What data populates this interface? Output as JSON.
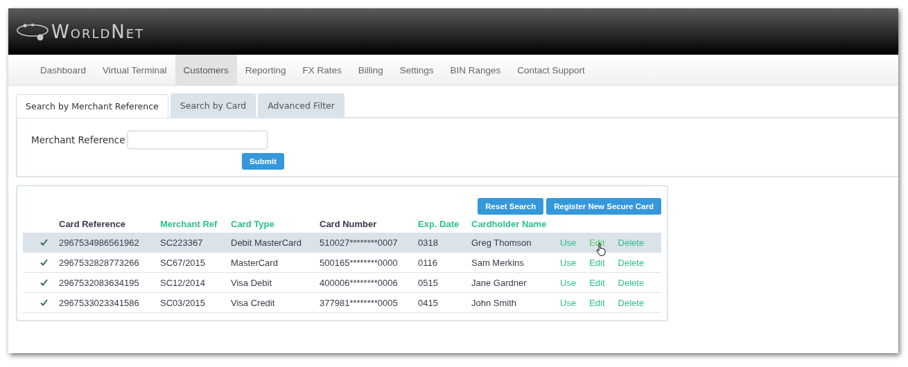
{
  "brand": {
    "logo_text": "WorldNet"
  },
  "nav": [
    {
      "label": "Dashboard",
      "selected": false
    },
    {
      "label": "Virtual Terminal",
      "selected": false
    },
    {
      "label": "Customers",
      "selected": true
    },
    {
      "label": "Reporting",
      "selected": false
    },
    {
      "label": "FX Rates",
      "selected": false
    },
    {
      "label": "Billing",
      "selected": false
    },
    {
      "label": "Settings",
      "selected": false
    },
    {
      "label": "BIN Ranges",
      "selected": false
    },
    {
      "label": "Contact Support",
      "selected": false
    }
  ],
  "search_tabs": [
    {
      "label": "Search by Merchant Reference",
      "selected": true
    },
    {
      "label": "Search by Card",
      "selected": false
    },
    {
      "label": "Advanced Filter",
      "selected": false
    }
  ],
  "search_form": {
    "label": "Merchant Reference",
    "submit": "Submit"
  },
  "actions": [
    "Reset Search",
    "Register New Secure Card"
  ],
  "table": {
    "columns": [
      {
        "label": "Card Reference",
        "sortable": false
      },
      {
        "label": "Merchant Ref",
        "sortable": true
      },
      {
        "label": "Card Type",
        "sortable": true
      },
      {
        "label": "Card Number",
        "sortable": false
      },
      {
        "label": "Exp. Date",
        "sortable": true
      },
      {
        "label": "Cardholder Name",
        "sortable": true
      }
    ],
    "rows": [
      {
        "active": true,
        "selected": true,
        "pointer": true,
        "cells": [
          "2967534986561962",
          "SC223367",
          "Debit MasterCard",
          "510027********0007",
          "0318",
          "Greg Thomson"
        ],
        "links": [
          "Use",
          "Edit",
          "Delete"
        ]
      },
      {
        "active": true,
        "selected": false,
        "pointer": false,
        "cells": [
          "2967532828773266",
          "SC67/2015",
          "MasterCard",
          "500165********0000",
          "0116",
          "Sam Merkins"
        ],
        "links": [
          "Use",
          "Edit",
          "Delete"
        ]
      },
      {
        "active": true,
        "selected": false,
        "pointer": false,
        "cells": [
          "2967532083634195",
          "SC12/2014",
          "Visa Debit",
          "400006********0006",
          "0515",
          "Jane Gardner"
        ],
        "links": [
          "Use",
          "Edit",
          "Delete"
        ]
      },
      {
        "active": true,
        "selected": false,
        "pointer": false,
        "cells": [
          "2967533023341586",
          "SC03/2015",
          "Visa Credit",
          "377981********0005",
          "0415",
          "John Smith"
        ],
        "links": [
          "Use",
          "Edit",
          "Delete"
        ]
      }
    ]
  }
}
